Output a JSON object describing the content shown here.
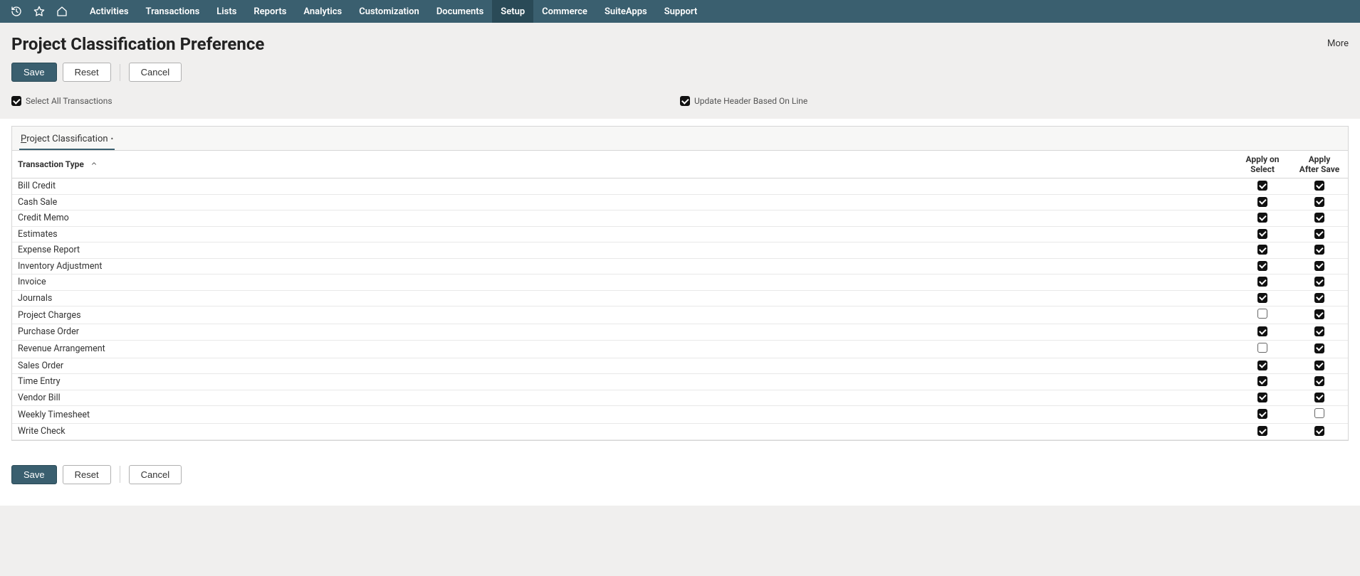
{
  "nav": {
    "items": [
      {
        "label": "Activities",
        "active": false
      },
      {
        "label": "Transactions",
        "active": false
      },
      {
        "label": "Lists",
        "active": false
      },
      {
        "label": "Reports",
        "active": false
      },
      {
        "label": "Analytics",
        "active": false
      },
      {
        "label": "Customization",
        "active": false
      },
      {
        "label": "Documents",
        "active": false
      },
      {
        "label": "Setup",
        "active": true
      },
      {
        "label": "Commerce",
        "active": false
      },
      {
        "label": "SuiteApps",
        "active": false
      },
      {
        "label": "Support",
        "active": false
      }
    ]
  },
  "header": {
    "title": "Project Classification Preference",
    "more": "More",
    "buttons": {
      "save": "Save",
      "reset": "Reset",
      "cancel": "Cancel"
    }
  },
  "options": {
    "select_all": {
      "label": "Select All Transactions",
      "checked": true
    },
    "update_header": {
      "label": "Update Header Based On Line",
      "checked": true
    }
  },
  "subtab": {
    "label": "Project Classification",
    "has_change": true
  },
  "table": {
    "columns": {
      "tt": "Transaction Type",
      "apply_select_l1": "Apply on",
      "apply_select_l2": "Select",
      "apply_after_l1": "Apply",
      "apply_after_l2": "After Save"
    },
    "rows": [
      {
        "tt": "Bill Credit",
        "select": true,
        "after": true
      },
      {
        "tt": "Cash Sale",
        "select": true,
        "after": true
      },
      {
        "tt": "Credit Memo",
        "select": true,
        "after": true
      },
      {
        "tt": "Estimates",
        "select": true,
        "after": true
      },
      {
        "tt": "Expense Report",
        "select": true,
        "after": true
      },
      {
        "tt": "Inventory Adjustment",
        "select": true,
        "after": true
      },
      {
        "tt": "Invoice",
        "select": true,
        "after": true
      },
      {
        "tt": "Journals",
        "select": true,
        "after": true
      },
      {
        "tt": "Project Charges",
        "select": false,
        "after": true
      },
      {
        "tt": "Purchase Order",
        "select": true,
        "after": true
      },
      {
        "tt": "Revenue Arrangement",
        "select": false,
        "after": true
      },
      {
        "tt": "Sales Order",
        "select": true,
        "after": true
      },
      {
        "tt": "Time Entry",
        "select": true,
        "after": true
      },
      {
        "tt": "Vendor Bill",
        "select": true,
        "after": true
      },
      {
        "tt": "Weekly Timesheet",
        "select": true,
        "after": false
      },
      {
        "tt": "Write Check",
        "select": true,
        "after": true
      }
    ]
  }
}
